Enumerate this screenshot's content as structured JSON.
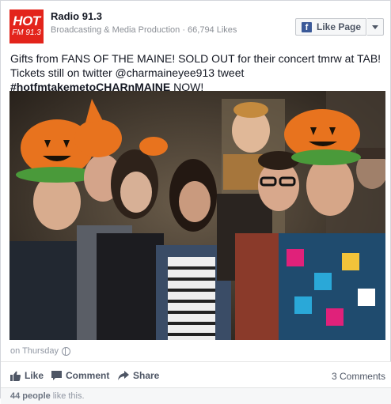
{
  "page": {
    "logo_top": "HOT",
    "logo_bottom": "FM 91.3",
    "name": "Radio 91.3",
    "subtitle": "Broadcasting & Media Production · 66,794 Likes",
    "like_button": "Like Page"
  },
  "post": {
    "text": "Gifts from FANS OF THE MAINE! SOLD OUT for their concert tmrw at TAB! Tickets still on twitter @charmaineyee913 tweet ",
    "hashtag": "#hotfmtakemetoCHARnMAINE",
    "text_end": " NOW!",
    "timestamp": "on Thursday"
  },
  "actions": {
    "like": "Like",
    "comment": "Comment",
    "share": "Share",
    "comments_count": "3 Comments"
  },
  "likes": {
    "count": "44 people",
    "suffix": " like this."
  },
  "colors": {
    "brand_red": "#e3241b",
    "facebook_blue": "#3b5998",
    "pumpkin_orange": "#e8731e"
  },
  "icons": [
    "facebook-f-icon",
    "caret-down-icon",
    "globe-icon",
    "thumbs-up-icon",
    "comment-icon",
    "share-arrow-icon"
  ]
}
